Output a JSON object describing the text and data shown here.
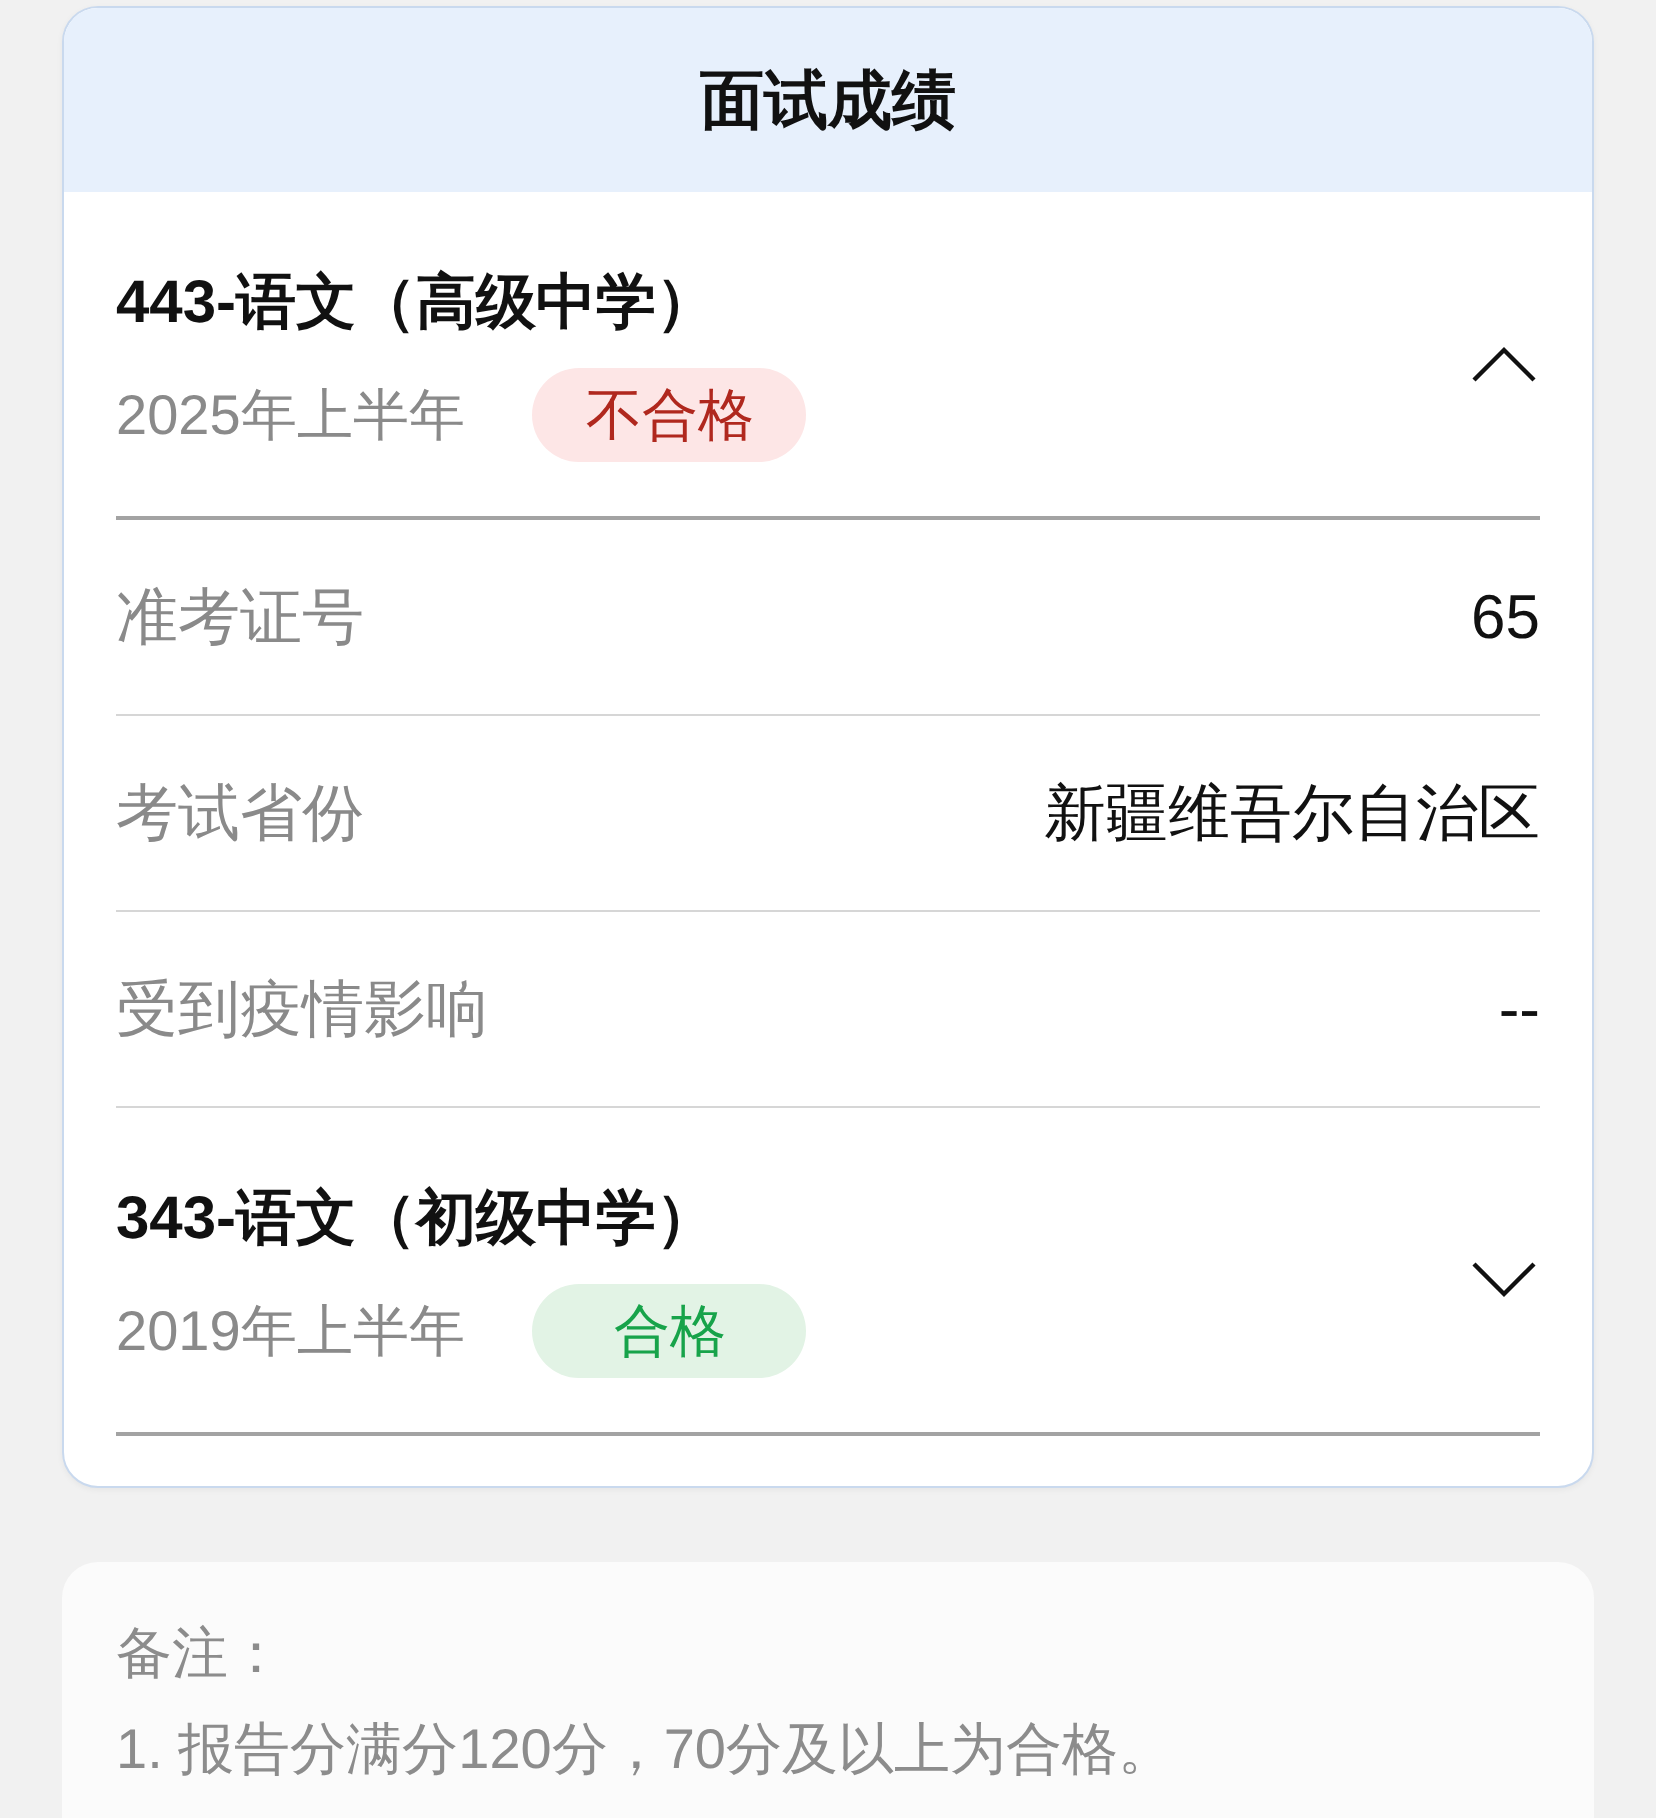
{
  "header": {
    "title": "面试成绩"
  },
  "subjects": [
    {
      "title": "443-语文（高级中学）",
      "session": "2025年上半年",
      "result": {
        "label": "不合格",
        "kind": "fail"
      },
      "expanded": true,
      "details": [
        {
          "label": "准考证号",
          "value": "65"
        },
        {
          "label": "考试省份",
          "value": "新疆维吾尔自治区"
        },
        {
          "label": "受到疫情影响",
          "value": "--"
        }
      ]
    },
    {
      "title": "343-语文（初级中学）",
      "session": "2019年上半年",
      "result": {
        "label": "合格",
        "kind": "pass"
      },
      "expanded": false
    }
  ],
  "notes": {
    "heading": "备注：",
    "lines": [
      "1. 报告分满分120分，70分及以上为合格。"
    ]
  }
}
